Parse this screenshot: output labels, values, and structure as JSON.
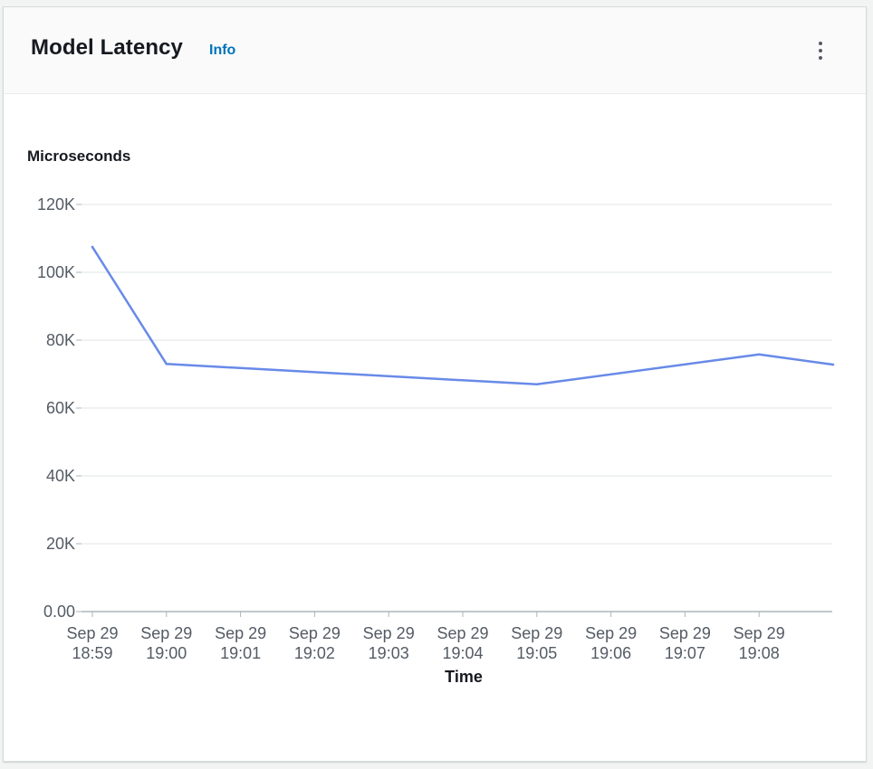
{
  "widget": {
    "title": "Model Latency",
    "info_label": "Info",
    "menu_icon": "vertical-ellipsis-icon"
  },
  "colors": {
    "series_line": "#688ae8",
    "info_link": "#0073bb",
    "gridline": "#e0e4e6"
  },
  "chart_data": {
    "type": "line",
    "title": "Model Latency",
    "ylabel": "Microseconds",
    "xlabel": "Time",
    "ylim": [
      0,
      120000
    ],
    "y_ticks": [
      0,
      20000,
      40000,
      60000,
      80000,
      100000,
      120000
    ],
    "y_tick_labels": [
      "0.00",
      "20K",
      "40K",
      "60K",
      "80K",
      "100K",
      "120K"
    ],
    "x_ticks": [
      {
        "date": "Sep 29",
        "time": "18:59"
      },
      {
        "date": "Sep 29",
        "time": "19:00"
      },
      {
        "date": "Sep 29",
        "time": "19:01"
      },
      {
        "date": "Sep 29",
        "time": "19:02"
      },
      {
        "date": "Sep 29",
        "time": "19:03"
      },
      {
        "date": "Sep 29",
        "time": "19:04"
      },
      {
        "date": "Sep 29",
        "time": "19:05"
      },
      {
        "date": "Sep 29",
        "time": "19:06"
      },
      {
        "date": "Sep 29",
        "time": "19:07"
      },
      {
        "date": "Sep 29",
        "time": "19:08"
      }
    ],
    "xlim": [
      "18:59",
      "19:09"
    ],
    "grid": true,
    "series": [
      {
        "points": [
          {
            "x": "18:59",
            "y": 107500
          },
          {
            "x": "19:00",
            "y": 73000
          },
          {
            "x": "19:05",
            "y": 67000
          },
          {
            "x": "19:08",
            "y": 75800
          },
          {
            "x": "19:09",
            "y": 72800
          }
        ]
      }
    ]
  }
}
